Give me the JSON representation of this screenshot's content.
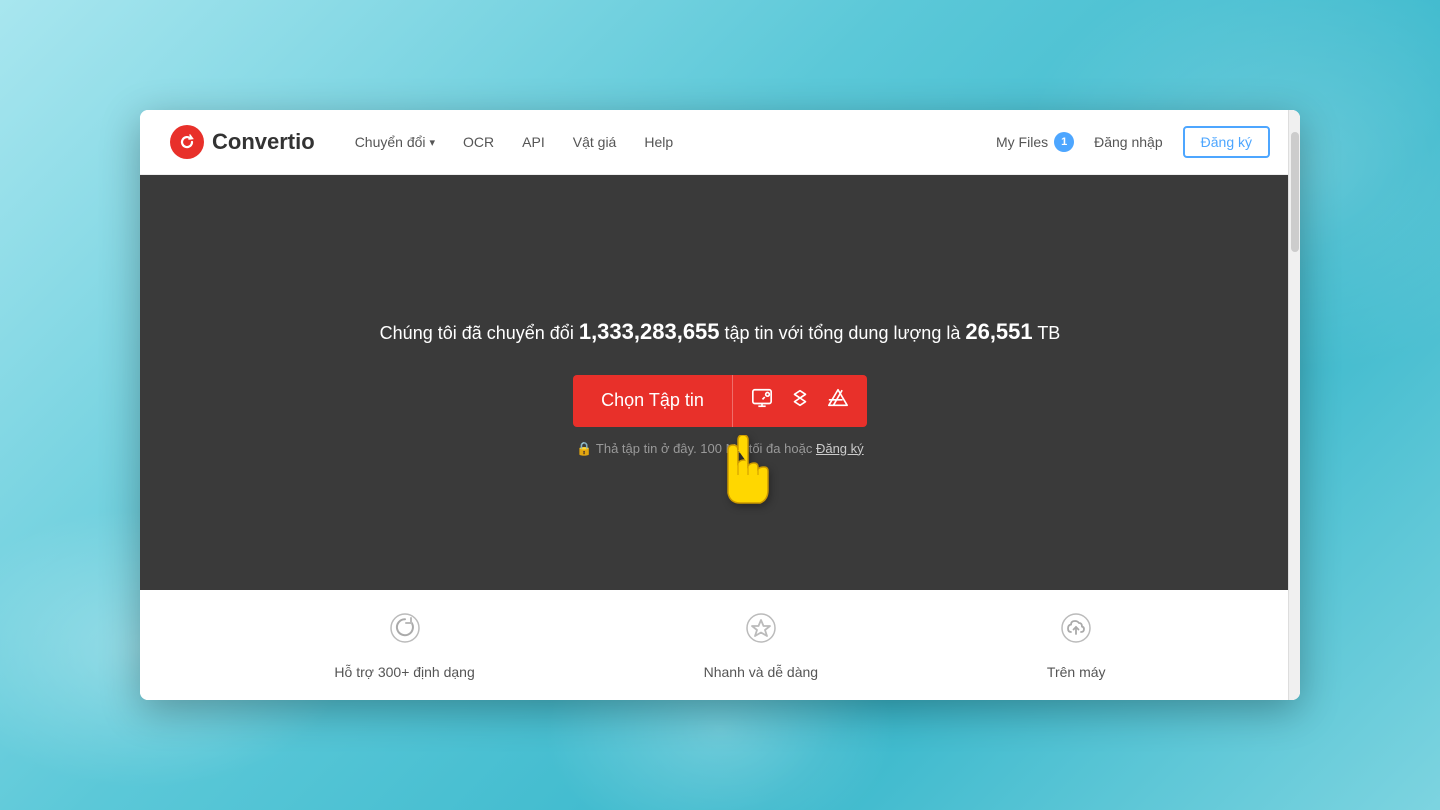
{
  "page": {
    "title": "Convertio"
  },
  "navbar": {
    "logo_text": "Convertio",
    "nav_items": [
      {
        "label": "Chuyển đổi",
        "has_dropdown": true
      },
      {
        "label": "OCR",
        "has_dropdown": false
      },
      {
        "label": "API",
        "has_dropdown": false
      },
      {
        "label": "Vật giá",
        "has_dropdown": false
      },
      {
        "label": "Help",
        "has_dropdown": false
      }
    ],
    "my_files_label": "My Files",
    "my_files_count": "1",
    "login_label": "Đăng nhập",
    "register_label": "Đăng ký"
  },
  "hero": {
    "stats_prefix": "Chúng tôi đã chuyển đổi ",
    "stats_count": "1,333,283,655",
    "stats_middle": " tập tin với tổng dung lượng là ",
    "stats_size": "26,551",
    "stats_suffix": " TB",
    "choose_file_label": "Chọn Tập tin",
    "drag_hint": "Thả tập tin ở đây. 100 MB tối đa hoặc",
    "drag_hint_link": "Đăng ký"
  },
  "features": [
    {
      "icon": "refresh-icon",
      "label": "Hỗ trợ 300+ định dạng"
    },
    {
      "icon": "star-icon",
      "label": "Nhanh và dễ dàng"
    },
    {
      "icon": "cloud-upload-icon",
      "label": "Trên máy"
    }
  ],
  "colors": {
    "accent_red": "#e8302a",
    "accent_blue": "#4da6ff",
    "hero_bg": "#3a3a3a",
    "nav_bg": "#ffffff"
  }
}
